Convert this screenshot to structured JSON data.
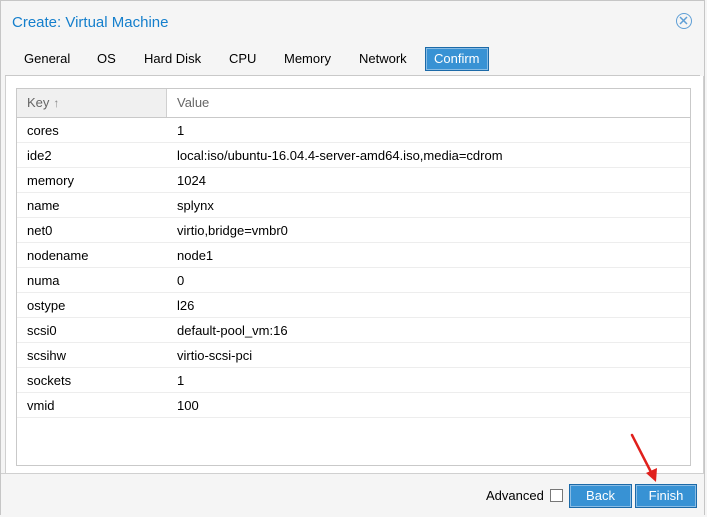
{
  "dialog": {
    "title": "Create: Virtual Machine"
  },
  "tabs": [
    {
      "label": "General"
    },
    {
      "label": "OS"
    },
    {
      "label": "Hard Disk"
    },
    {
      "label": "CPU"
    },
    {
      "label": "Memory"
    },
    {
      "label": "Network"
    },
    {
      "label": "Confirm",
      "active": true
    }
  ],
  "grid": {
    "headers": {
      "key": "Key",
      "value": "Value"
    },
    "sort": "ascending",
    "rows": [
      {
        "key": "cores",
        "value": "1"
      },
      {
        "key": "ide2",
        "value": "local:iso/ubuntu-16.04.4-server-amd64.iso,media=cdrom"
      },
      {
        "key": "memory",
        "value": "1024"
      },
      {
        "key": "name",
        "value": "splynx"
      },
      {
        "key": "net0",
        "value": "virtio,bridge=vmbr0"
      },
      {
        "key": "nodename",
        "value": "node1"
      },
      {
        "key": "numa",
        "value": "0"
      },
      {
        "key": "ostype",
        "value": "l26"
      },
      {
        "key": "scsi0",
        "value": "default-pool_vm:16"
      },
      {
        "key": "scsihw",
        "value": "virtio-scsi-pci"
      },
      {
        "key": "sockets",
        "value": "1"
      },
      {
        "key": "vmid",
        "value": "100"
      }
    ]
  },
  "footer": {
    "advanced_label": "Advanced",
    "advanced_checked": false,
    "back_label": "Back",
    "finish_label": "Finish"
  },
  "colors": {
    "accent": "#157fcc",
    "button": "#3892d4",
    "annotation_arrow": "#e0201c"
  }
}
